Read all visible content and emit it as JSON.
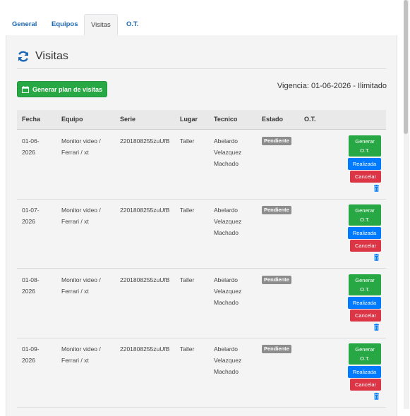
{
  "tabs": [
    {
      "label": "General",
      "active": false
    },
    {
      "label": "Equipos",
      "active": false
    },
    {
      "label": "Visitas",
      "active": true
    },
    {
      "label": "O.T.",
      "active": false
    }
  ],
  "section": {
    "title": "Visitas",
    "icon": "refresh-icon"
  },
  "generate_button": {
    "label": "Generar plan de visitas",
    "icon": "calendar-icon"
  },
  "vigencia": "Vigencia: 01-06-2026 - Ilimitado",
  "table": {
    "columns": [
      "Fecha",
      "Equipo",
      "Serie",
      "Lugar",
      "Tecnico",
      "Estado",
      "O.T."
    ],
    "rows": [
      {
        "fecha": "01-06-\n2026",
        "equipo": "Monitor video /\nFerrari / xt",
        "serie": "2201808255zuUfB",
        "lugar": "Taller",
        "tecnico": "Abelardo\nVelazquez\nMachado",
        "estado": "Pendiente"
      },
      {
        "fecha": "01-07-\n2026",
        "equipo": "Monitor video /\nFerrari / xt",
        "serie": "2201808255zuUfB",
        "lugar": "Taller",
        "tecnico": "Abelardo\nVelazquez\nMachado",
        "estado": "Pendiente"
      },
      {
        "fecha": "01-08-\n2026",
        "equipo": "Monitor video /\nFerrari / xt",
        "serie": "2201808255zuUfB",
        "lugar": "Taller",
        "tecnico": "Abelardo\nVelazquez\nMachado",
        "estado": "Pendiente"
      },
      {
        "fecha": "01-09-\n2026",
        "equipo": "Monitor video /\nFerrari / xt",
        "serie": "2201808255zuUfB",
        "lugar": "Taller",
        "tecnico": "Abelardo\nVelazquez\nMachado",
        "estado": "Pendiente"
      }
    ],
    "actions": {
      "generate_ot": "Generar\nO.T.",
      "done": "Realizada",
      "cancel": "Cancelar",
      "delete_icon": "trash-icon"
    }
  },
  "colors": {
    "green": "#28a745",
    "blue": "#007bff",
    "red": "#dc3545",
    "badge": "#8c8c8c",
    "link": "#1b67b3"
  }
}
